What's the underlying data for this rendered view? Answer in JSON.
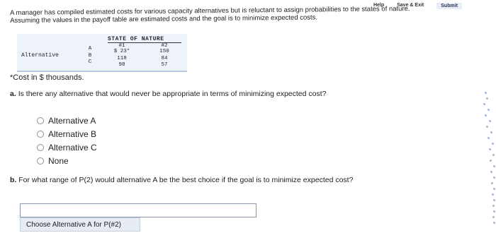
{
  "topbar": {
    "help": "Help",
    "save_exit": "Save & Exit",
    "submit": "Submit"
  },
  "intro": {
    "line1": "A manager has compiled estimated costs for various capacity alternatives but is reluctant to assign probabilities to the states of nature.",
    "line2": "Assuming the values in the payoff table are estimated costs and the goal is to minimize expected costs."
  },
  "payoff_table": {
    "header": "STATE OF NATURE",
    "col1": "#1",
    "col2": "#2",
    "row_header": "Alternative",
    "rows": [
      {
        "label": "A",
        "s1": "$ 23*",
        "s2": "150"
      },
      {
        "label": "B",
        "s1": "118",
        "s2": "84"
      },
      {
        "label": "C",
        "s1": "98",
        "s2": "57"
      }
    ]
  },
  "note": "*Cost in $ thousands.",
  "question_a": {
    "prefix": "a.",
    "text": "Is there any alternative that would never be appropriate in terms of minimizing expected cost?"
  },
  "options": [
    "Alternative A",
    "Alternative B",
    "Alternative C",
    "None"
  ],
  "question_b": {
    "prefix": "b.",
    "text": "For what range of P(2) would alternative A be the best choice if the goal is to minimize expected cost?"
  },
  "answer_b": {
    "value": "",
    "label": "Choose Alternative A for P(#2)"
  }
}
